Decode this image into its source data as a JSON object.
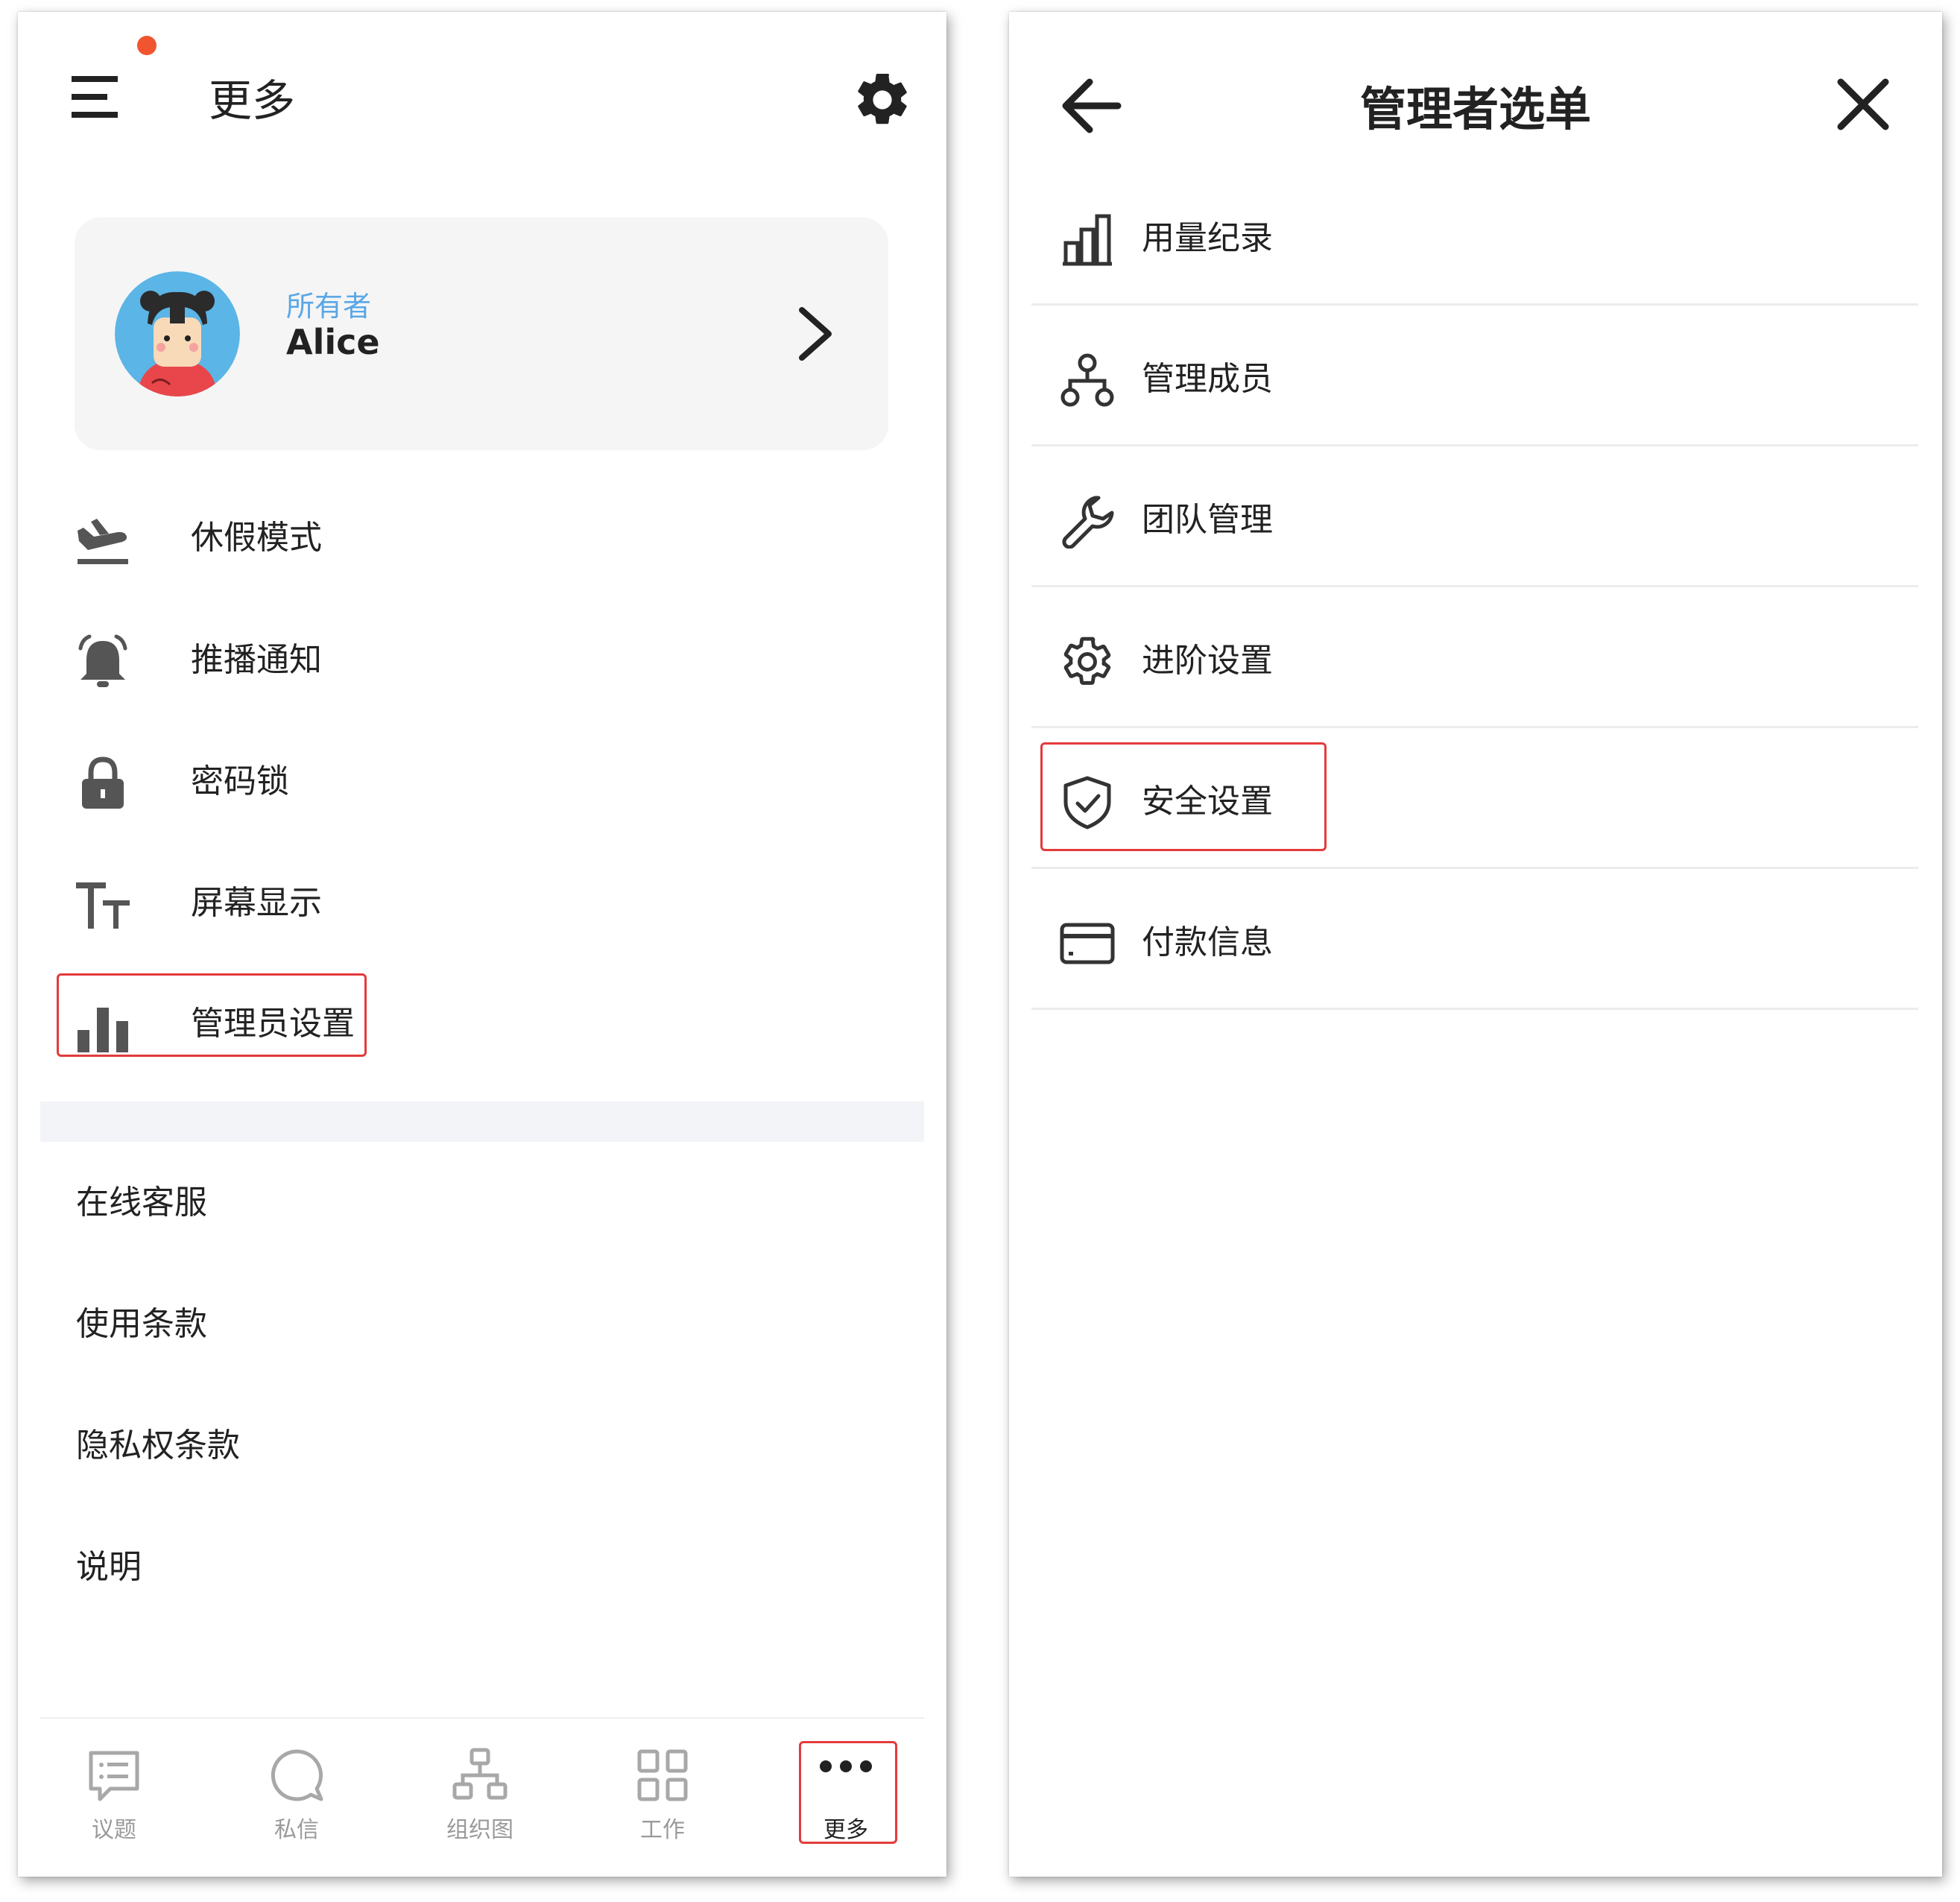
{
  "left_screen": {
    "title": "更多",
    "profile": {
      "role": "所有者",
      "name": "Alice"
    },
    "menu": [
      {
        "label": "休假模式",
        "icon": "vacation-plane-icon"
      },
      {
        "label": "推播通知",
        "icon": "bell-icon"
      },
      {
        "label": "密码锁",
        "icon": "lock-icon"
      },
      {
        "label": "屏幕显示",
        "icon": "text-size-icon"
      },
      {
        "label": "管理员设置",
        "icon": "bar-chart-icon"
      }
    ],
    "links": [
      "在线客服",
      "使用条款",
      "隐私权条款",
      "说明"
    ],
    "tabs": [
      {
        "label": "议题",
        "icon": "topic-icon"
      },
      {
        "label": "私信",
        "icon": "chat-bubble-icon"
      },
      {
        "label": "组织图",
        "icon": "org-chart-icon"
      },
      {
        "label": "工作",
        "icon": "grid-icon"
      },
      {
        "label": "更多",
        "icon": "more-dots-icon"
      }
    ]
  },
  "right_screen": {
    "title": "管理者选单",
    "menu": [
      {
        "label": "用量纪录",
        "icon": "usage-chart-icon"
      },
      {
        "label": "管理成员",
        "icon": "member-tree-icon"
      },
      {
        "label": "团队管理",
        "icon": "wrench-icon"
      },
      {
        "label": "进阶设置",
        "icon": "gear-icon"
      },
      {
        "label": "安全设置",
        "icon": "shield-check-icon"
      },
      {
        "label": "付款信息",
        "icon": "credit-card-icon"
      }
    ]
  },
  "colors": {
    "highlight": "#e43b3b",
    "notification_dot": "#f0552f",
    "role_text": "#5aa7e6",
    "avatar_bg": "#5bb5e6"
  }
}
